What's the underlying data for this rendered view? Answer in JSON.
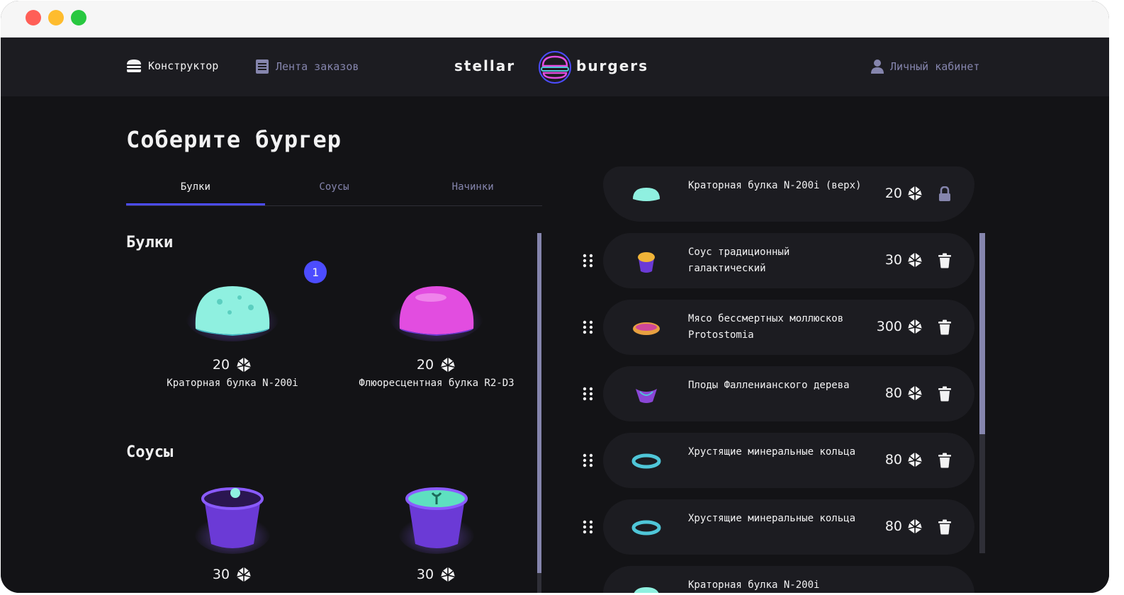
{
  "window": {
    "controls": [
      "close",
      "minimize",
      "maximize"
    ]
  },
  "header": {
    "nav_constructor": {
      "label": "Конструктор",
      "icon": "burger-icon"
    },
    "nav_feed": {
      "label": "Лента заказов",
      "icon": "list-icon"
    },
    "logo": {
      "left": "stellar",
      "right": "burgers"
    },
    "nav_profile": {
      "label": "Личный кабинет",
      "icon": "profile-icon"
    }
  },
  "page": {
    "title": "Соберите бургер",
    "tabs": [
      {
        "label": "Булки",
        "active": true
      },
      {
        "label": "Соусы",
        "active": false
      },
      {
        "label": "Начинки",
        "active": false
      }
    ]
  },
  "ingredients": {
    "buns_title": "Булки",
    "sauces_title": "Соусы",
    "buns": [
      {
        "name": "Краторная булка N-200i",
        "price": "20",
        "count": "1",
        "color": "#7fe3d5"
      },
      {
        "name": "Флюоресцентная булка R2-D3",
        "price": "20",
        "color": "#e24de0"
      }
    ],
    "sauces": [
      {
        "price": "30",
        "color": "#6b3ad6"
      },
      {
        "price": "30",
        "color": "#6b3ad6"
      }
    ]
  },
  "constructor": {
    "top": {
      "name": "Краторная булка N-200i (верх)",
      "price": "20"
    },
    "items": [
      {
        "name": "Соус традиционный галактический",
        "price": "30",
        "color": "#f0b438"
      },
      {
        "name": "Мясо бессмертных моллюсков Protostomia",
        "price": "300",
        "color": "#e88840"
      },
      {
        "name": "Плоды Фалленианского дерева",
        "price": "80",
        "color": "#8a46d6"
      },
      {
        "name": "Хрустящие минеральные кольца",
        "price": "80",
        "color": "#4fc6d8"
      },
      {
        "name": "Хрустящие минеральные кольца",
        "price": "80",
        "color": "#4fc6d8"
      }
    ],
    "bottom": {
      "name": "Краторная булка N-200i"
    }
  },
  "colors": {
    "accent": "#4c4cff",
    "background": "#131316",
    "card": "#1c1c21",
    "inactive": "#8585ad"
  }
}
